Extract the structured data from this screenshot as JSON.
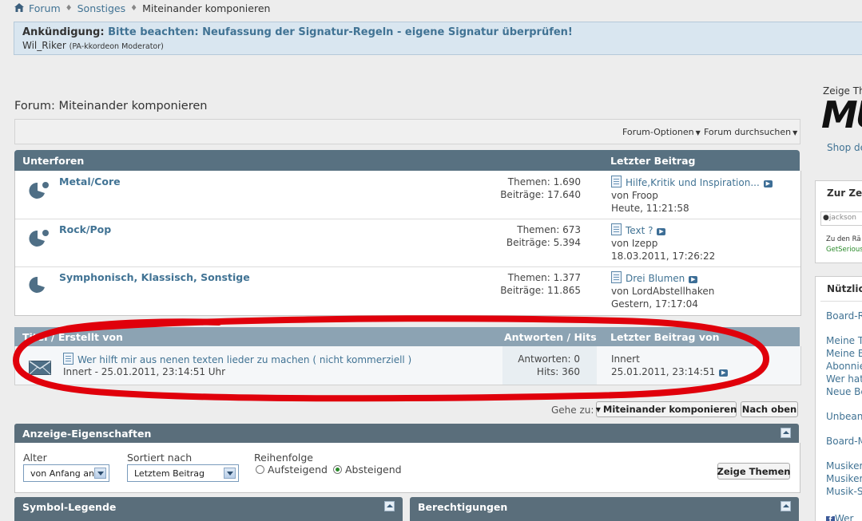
{
  "breadcrumb": {
    "items": [
      "Forum",
      "Sonstiges"
    ],
    "current": "Miteinander komponieren"
  },
  "announcement": {
    "label": "Ankündigung:",
    "text": "Bitte beachten: Neufassung der Signatur-Regeln - eigene Signatur überprüfen!",
    "author": "Wil_Riker",
    "role": "(PA-kkordeon Moderator)"
  },
  "page_title": "Forum: Miteinander komponieren",
  "options": {
    "forum_options": "Forum-Optionen",
    "search_forum": "Forum durchsuchen"
  },
  "subforums": {
    "header": "Unterforen",
    "last_post_header": "Letzter Beitrag",
    "rows": [
      {
        "name": "Metal/Core",
        "threads": "Themen: 1.690",
        "posts": "Beiträge: 17.640",
        "last_title": "Hilfe,Kritik und Inspiration...",
        "last_by": "von Froop",
        "last_date": "Heute, 11:21:58"
      },
      {
        "name": "Rock/Pop",
        "threads": "Themen: 673",
        "posts": "Beiträge: 5.394",
        "last_title": "Text ?",
        "last_by": "von Izepp",
        "last_date": "18.03.2011, 17:26:22"
      },
      {
        "name": "Symphonisch, Klassisch, Sonstige",
        "threads": "Themen: 1.377",
        "posts": "Beiträge: 11.865",
        "last_title": "Drei Blumen",
        "last_by": "von LordAbstellhaken",
        "last_date": "Gestern, 17:17:04"
      }
    ]
  },
  "threads": {
    "header_title": "Titel / Erstellt von",
    "header_replies": "Antworten / Hits",
    "header_last": "Letzter Beitrag von",
    "rows": [
      {
        "title": "Wer hilft mir aus nenen texten lieder zu machen ( nicht kommerziell )",
        "meta": "Innert - 25.01.2011, 23:14:51 Uhr",
        "replies": "Antworten: 0",
        "hits": "Hits: 360",
        "last_by": "Innert",
        "last_date": "25.01.2011, 23:14:51"
      }
    ]
  },
  "goto": {
    "label": "Gehe zu:",
    "target": "Miteinander komponieren",
    "top": "Nach oben"
  },
  "display": {
    "title": "Anzeige-Eigenschaften",
    "age_label": "Alter",
    "age_value": "von Anfang an",
    "sort_label": "Sortiert nach",
    "sort_value": "Letztem Beitrag",
    "order_label": "Reihenfolge",
    "asc": "Aufsteigend",
    "desc": "Absteigend",
    "order_selected": "Absteigend",
    "submit": "Zeige Themen"
  },
  "legend_title": "Symbol-Legende",
  "permissions_title": "Berechtigungen",
  "sidebar": {
    "show_prefix": "Zeige Th",
    "banner_text": "MU",
    "shop": "Shop de",
    "box1_title": "Zur Zei",
    "box1_user": "jackson",
    "box1_line1": "Zu den Rä",
    "box1_line2": "GetSerious",
    "box2_title": "Nützlich",
    "links": [
      "Board-R",
      "Meine T",
      "Meine B",
      "Abonnie",
      "Wer hat",
      "Neue Be",
      "Unbeant",
      "Board-M",
      "Musiker-",
      "Musiker-",
      "Musik-S",
      "Wer"
    ]
  },
  "colors": {
    "accent": "#417394",
    "header": "#587181",
    "highlight": "#e0000b"
  }
}
